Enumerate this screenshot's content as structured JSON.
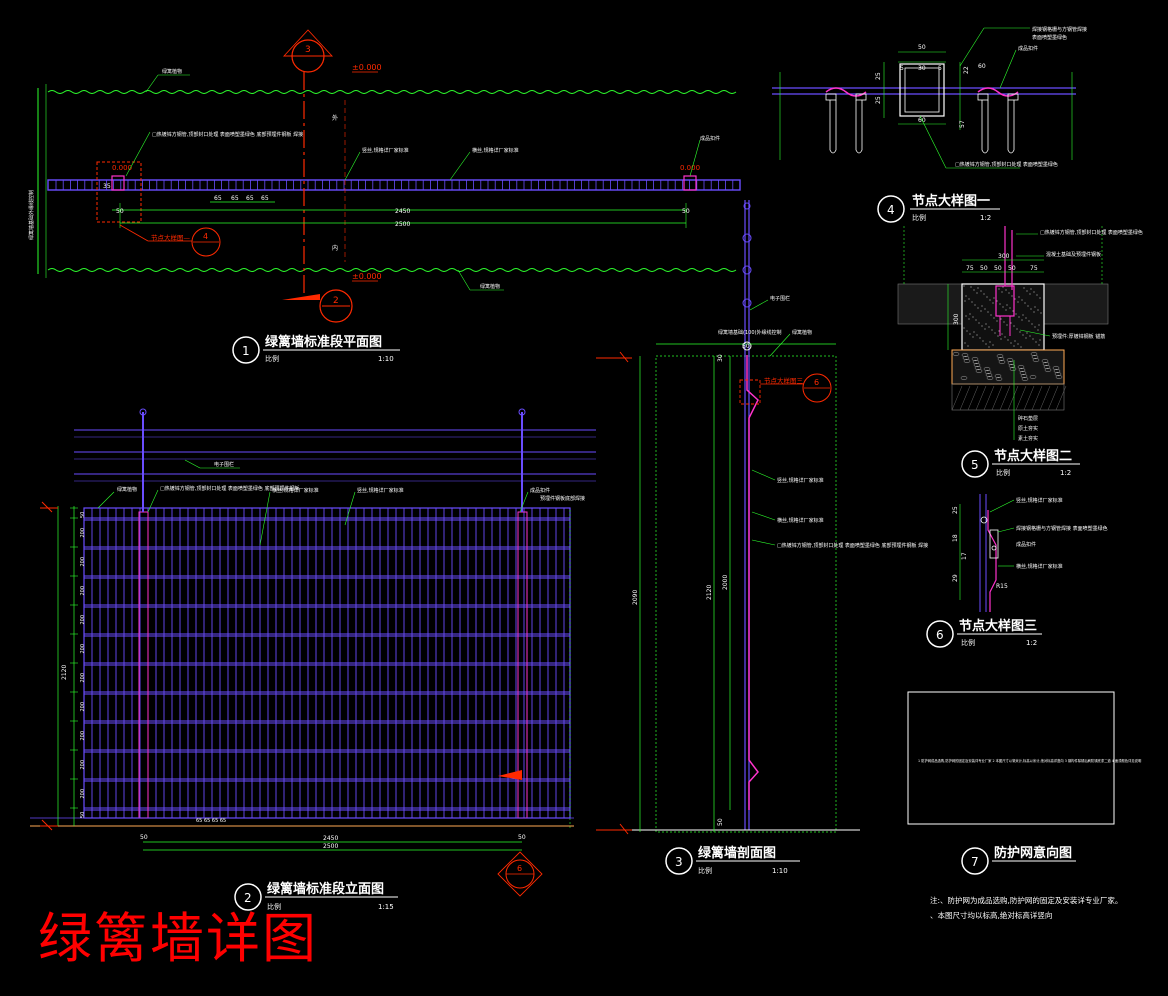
{
  "page_title": "绿篱墙详图",
  "colors": {
    "background": "#000000",
    "accent_red": "#ff0000",
    "dim_green": "#2dff2d",
    "fence_purple": "#6a4dff",
    "pink": "#ff33cc"
  },
  "views": {
    "v1": {
      "num": "1",
      "title": "绿篱墙标准段平面图",
      "scale_label": "比例",
      "scale": "1:10"
    },
    "v2": {
      "num": "2",
      "title": "绿篱墙标准段立面图",
      "scale_label": "比例",
      "scale": "1:15"
    },
    "v3": {
      "num": "3",
      "title": "绿篱墙剖面图",
      "scale_label": "比例",
      "scale": "1:10"
    },
    "v4": {
      "num": "4",
      "title": "节点大样图一",
      "scale_label": "比例",
      "scale": "1:2"
    },
    "v5": {
      "num": "5",
      "title": "节点大样图二",
      "scale_label": "比例",
      "scale": "1:2"
    },
    "v6": {
      "num": "6",
      "title": "节点大样图三",
      "scale_label": "比例",
      "scale": "1:2"
    },
    "v7": {
      "num": "7",
      "title": "防护网意向图"
    }
  },
  "section_marks": {
    "top": "3",
    "bottom": "2",
    "node4": "4",
    "node6": "6",
    "node5": "5",
    "sec_mark": "—"
  },
  "plan": {
    "elev_top": "±0.000",
    "elev_bottom": "±0.000",
    "elev_left": "0.000",
    "elev_right": "0.000",
    "dims": [
      "65",
      "65",
      "65",
      "65"
    ],
    "dim_2450": "2450",
    "dim_2500": "2500",
    "dim_50": "50",
    "dim_left_v": "35",
    "dim_left_v2": "50",
    "label_outer": "外",
    "label_inner": "内",
    "node_label": "节点大样图—",
    "leader_green_top": "绿篱植物",
    "leader_green_bottom": "绿篱植物",
    "leader_wall": "绿篱墙基础外缘线控制",
    "leader_post": "□热镀锌方钢管,顶部封口处理 表面喷塑墨绿色 底部预埋件钢板 焊接",
    "leader_mesh1": "竖丝,规格详厂家标准",
    "leader_mesh2": "横丝,规格详厂家标准",
    "leader_end": "成品扣件"
  },
  "elev": {
    "row_dims": [
      "50",
      "200",
      "200",
      "200",
      "200",
      "200",
      "200",
      "200",
      "200",
      "200",
      "200",
      "50"
    ],
    "dim_total_v": "2120",
    "dim_2450": "2450",
    "dim_2500": "2500",
    "dim_50": "50",
    "bottom_dims": "65 65 65 65",
    "leader_wire": "电子围栏",
    "leader_green": "绿篱植物",
    "leader_post": "□热镀锌方钢管,顶部封口处理 表面喷塑墨绿色 底部预埋件钢板",
    "leader_mesh": "横丝,规格详厂家标准",
    "leader_vert": "竖丝,规格详厂家标准",
    "leader_clip": "成品扣件",
    "leader_plate": "预埋件钢板底部焊接"
  },
  "section": {
    "dim_2090": "2090",
    "dim_2120": "2120",
    "dim_2000": "2000",
    "dim_50": "50",
    "dim_50b": "50",
    "dim_30": "30",
    "leader_top1": "电子围栏",
    "leader_top2": "绿篱墙基础(100)外缘线控制",
    "leader_top3": "绿篱植物",
    "leader_mid1": "竖丝,规格详厂家标准",
    "leader_mid2": "横丝,规格详厂家标准",
    "leader_mid3": "□热镀锌方钢管,顶部封口处理 表面喷塑墨绿色 底部预埋件钢板 焊接",
    "node_label": "节点大样图三"
  },
  "node4": {
    "d_top": "50",
    "d_inner": "30",
    "d_5a": "5",
    "d_5b": "5",
    "d_22": "22",
    "d_60": "60",
    "d_60b": "60",
    "d_25": "25",
    "d_25b": "25",
    "d_57": "57",
    "leader1": "焊接钢格栅与方钢管焊接",
    "leader2": "表面喷塑墨绿色",
    "leader3": "成品扣件",
    "leader4": "□热镀锌方钢管,顶部封口处理 表面喷塑墨绿色"
  },
  "node5": {
    "d_300": "300",
    "d_dims": [
      "75",
      "50",
      "50",
      "50",
      "75"
    ],
    "d_v": "300",
    "leader1": "□热镀锌方钢管,顶部封口处理 表面喷塑墨绿色",
    "leader2": "混凝土基础及预埋件钢板",
    "leader3": "预埋件:厚镀锌钢板 锚筋",
    "leader4": "碎石垫层",
    "leader5": "原土夯实",
    "leader6": "素土夯实"
  },
  "node6": {
    "d_25": "25",
    "d_17": "17",
    "d_18": "18",
    "d_29": "29",
    "d_r": "R15",
    "leader1": "竖丝,规格详厂家标准",
    "leader2": "焊接钢格栅与方钢管焊接 表面喷塑墨绿色",
    "leader3": "成品扣件",
    "leader4": "横丝,规格详厂家标准"
  },
  "intent_text": "1 防护网成品选购,防护网的固定及安装详专业厂家 2 本图尺寸以毫米计,标高以米计,绝对标高详竖向 3 钢构件除锈后刷防锈底漆二道 4 面漆颜色详见说明",
  "notes": {
    "line1": "注:、防护网为成品选购,防护网的固定及安装详专业厂家。",
    "line2": "、本图尺寸均以标高,绝对标高详竖向"
  }
}
